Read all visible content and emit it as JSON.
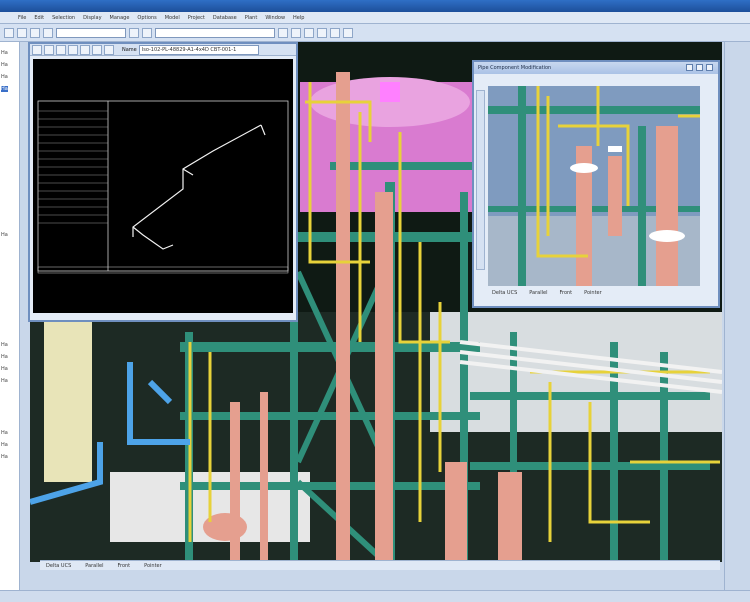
{
  "menubar": {
    "items": [
      "File",
      "Edit",
      "Selection",
      "Display",
      "Manage",
      "Options",
      "Model",
      "Project",
      "Database",
      "Plant",
      "Window",
      "Help"
    ]
  },
  "toolbar": {
    "combo1": "",
    "combo2": ""
  },
  "tree": {
    "items": [
      "Ha",
      "Ha",
      "Ha",
      "Ha",
      "Ha",
      "Ha",
      "Ha",
      "Ha",
      "Ha",
      "Ha",
      "Ha",
      "Ha"
    ]
  },
  "iso_window": {
    "name_label": "Name",
    "combo_value": "Iso-102-PL-48829-A1-4x4D CBT-001-1"
  },
  "pipe_component_window": {
    "title": "Pipe Component Modification",
    "subtitle": "",
    "tabs": [
      "Delta UCS",
      "Parallel",
      "Front",
      "Pointer"
    ]
  },
  "main_tabs": [
    "Delta UCS",
    "Parallel",
    "Front",
    "Pointer"
  ],
  "statusbar": {
    "left": "",
    "right": ""
  },
  "colors": {
    "steel": "#2f8f7a",
    "pipe": "#e7d23a",
    "vessel": "#e59f8f",
    "tank": "#d97bd0",
    "chrome": "#2f6fc6"
  }
}
